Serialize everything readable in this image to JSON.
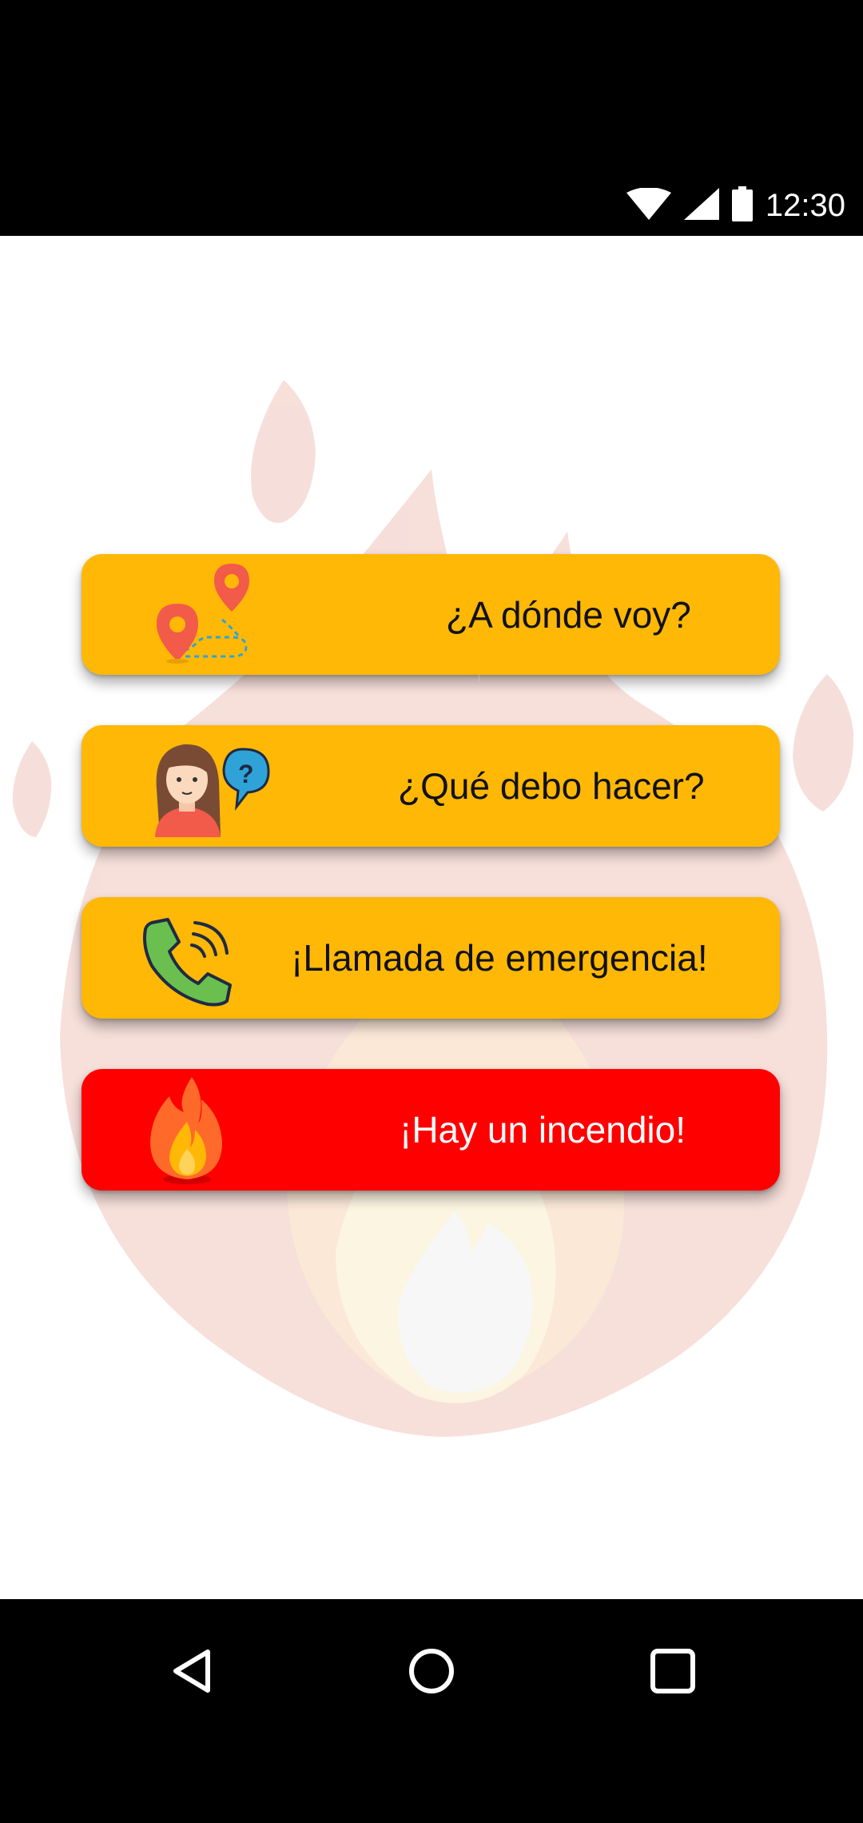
{
  "status_bar": {
    "time": "12:30",
    "icons": [
      "wifi-icon",
      "cell-signal-icon",
      "battery-icon"
    ]
  },
  "menu": {
    "items": [
      {
        "label": "¿A dónde voy?",
        "icon": "map-route-icon",
        "color": "#FFB806"
      },
      {
        "label": "¿Qué debo hacer?",
        "icon": "person-question-icon",
        "color": "#FFB806"
      },
      {
        "label": "¡Llamada de emergencia!",
        "icon": "phone-call-icon",
        "color": "#FFB806"
      },
      {
        "label": "¡Hay un incendio!",
        "icon": "fire-icon",
        "color": "#FF0000"
      }
    ]
  },
  "nav_bar": {
    "buttons": [
      "back-icon",
      "home-icon",
      "recents-icon"
    ]
  },
  "colors": {
    "accent": "#FFB806",
    "danger": "#FF0000",
    "background": "#FFFFFF"
  }
}
